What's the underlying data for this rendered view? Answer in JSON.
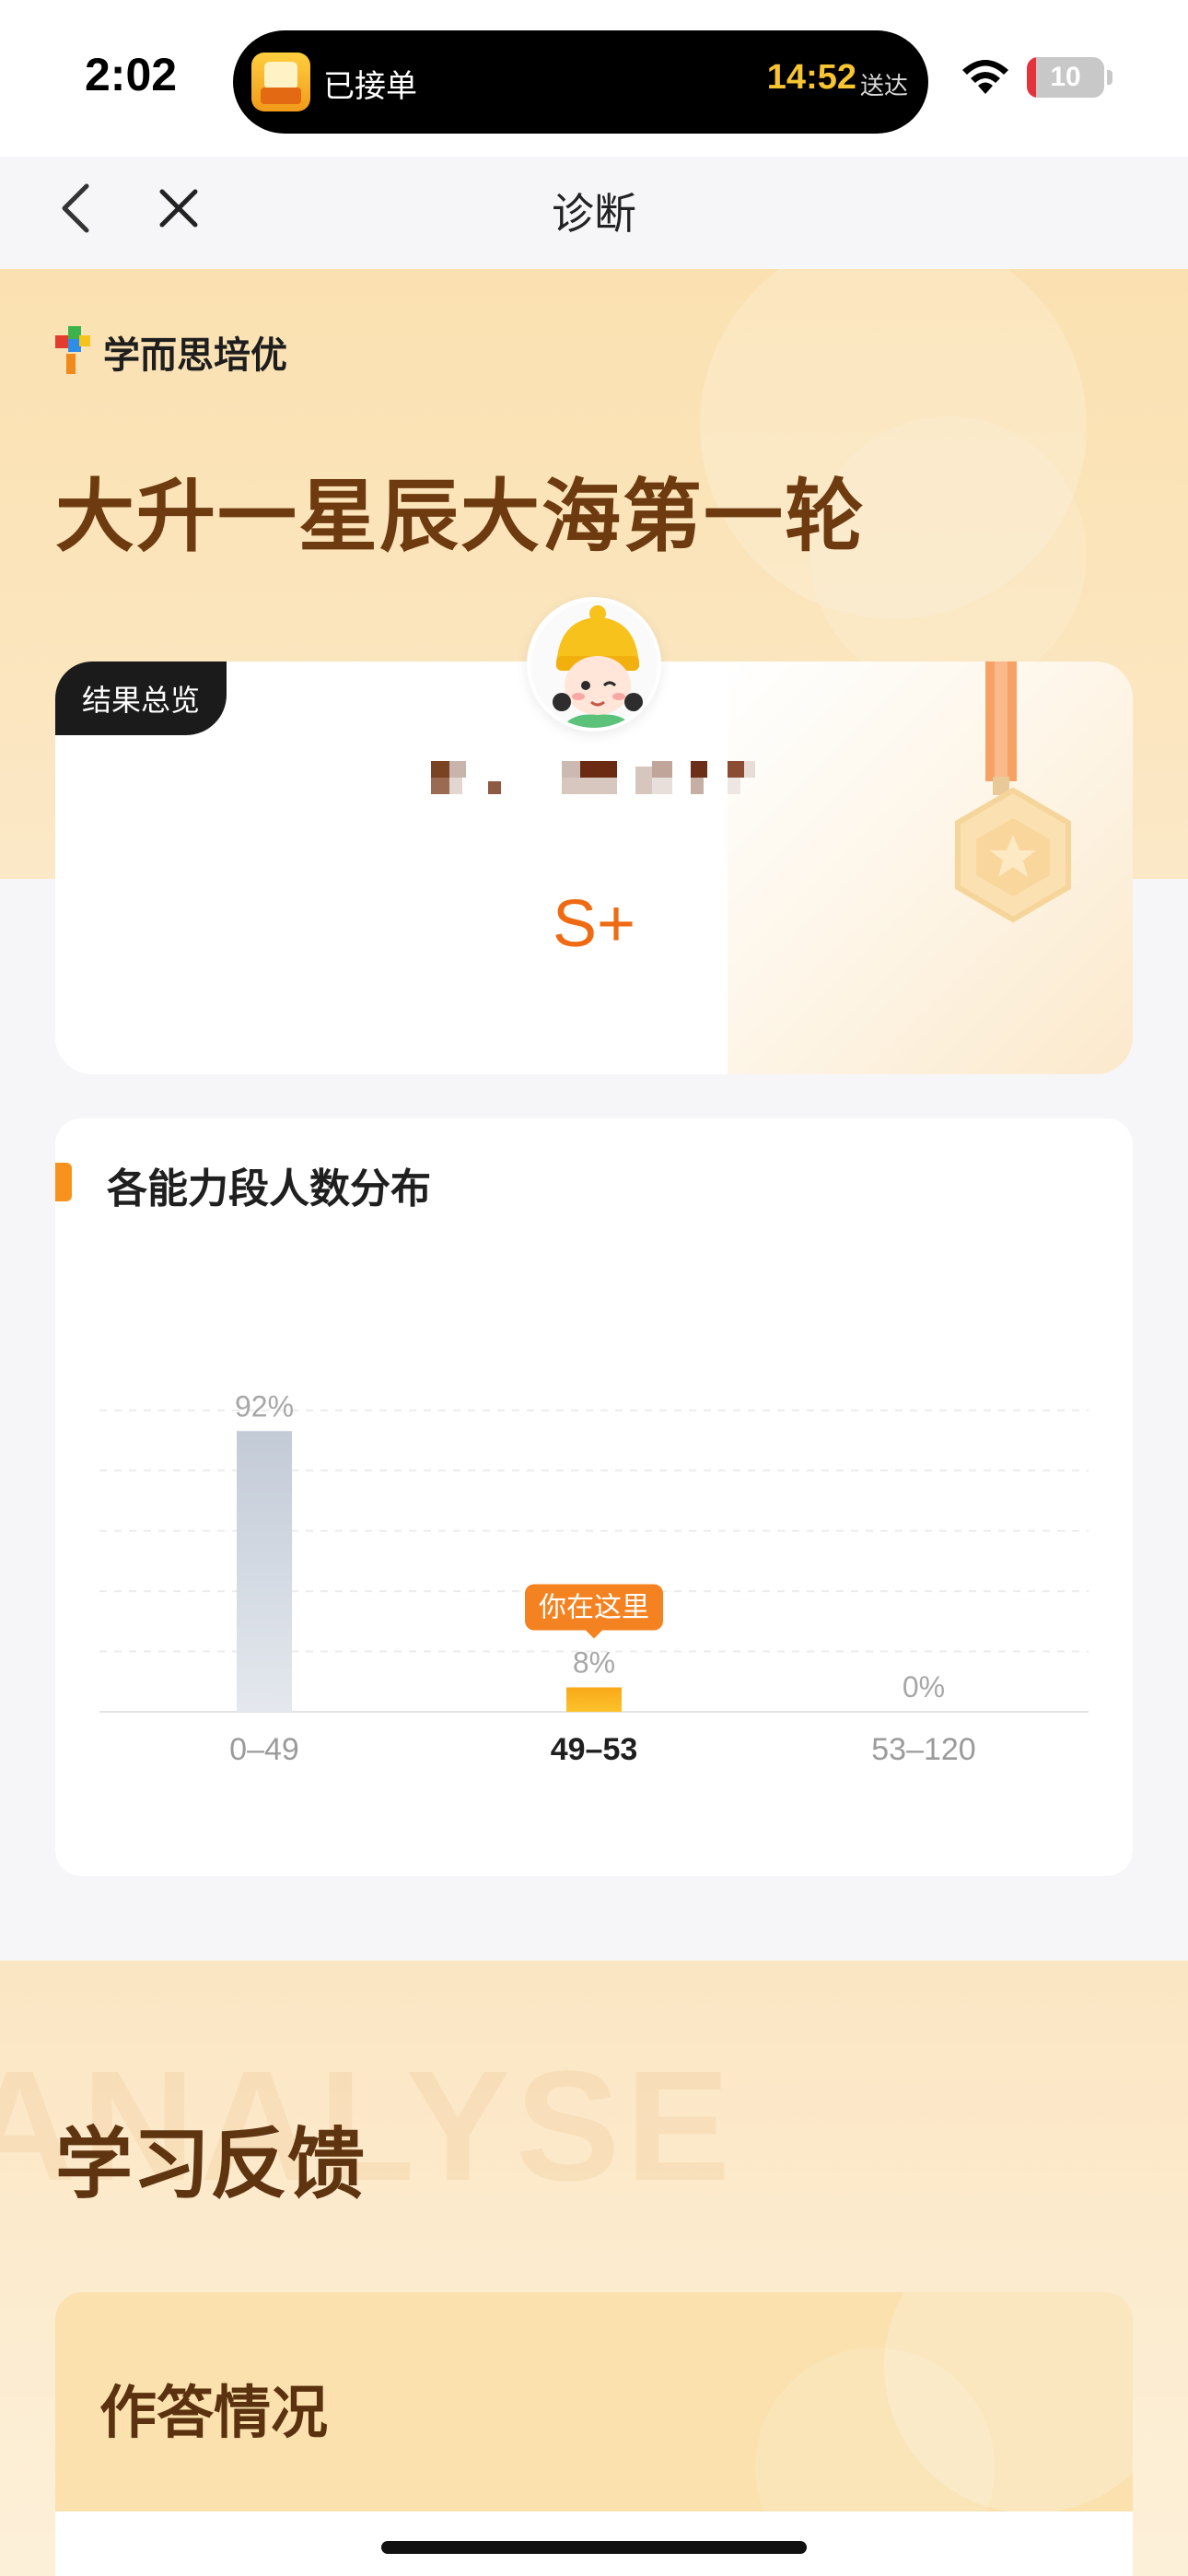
{
  "status_bar": {
    "time": "2:02",
    "island_status": "已接单",
    "island_time": "14:52",
    "island_sub": "送达",
    "battery_level": "10",
    "battery_fraction": 0.1
  },
  "nav": {
    "title": "诊断"
  },
  "hero": {
    "brand_name": "学而思培优",
    "title": "大升一星辰大海第一轮"
  },
  "result": {
    "badge": "结果总览",
    "grade": "S+"
  },
  "distribution": {
    "title": "各能力段人数分布",
    "you_are_here": "你在这里"
  },
  "chart_data": {
    "type": "bar",
    "categories": [
      "0–49",
      "49–53",
      "53–120"
    ],
    "values": [
      92,
      8,
      0
    ],
    "value_labels": [
      "92%",
      "8%",
      "0%"
    ],
    "highlight_index": 1,
    "ylim": [
      0,
      100
    ],
    "grid": true,
    "colors": {
      "default": "#c3cbd7",
      "highlight": "#f9b11b",
      "tag": "#f58220"
    }
  },
  "feedback": {
    "watermark": "ANALYSE",
    "title": "学习反馈",
    "answer_title": "作答情况"
  },
  "colors": {
    "accent": "#f58220",
    "hero_bg": "#fbe1b1",
    "title_brown": "#6e3a10"
  }
}
